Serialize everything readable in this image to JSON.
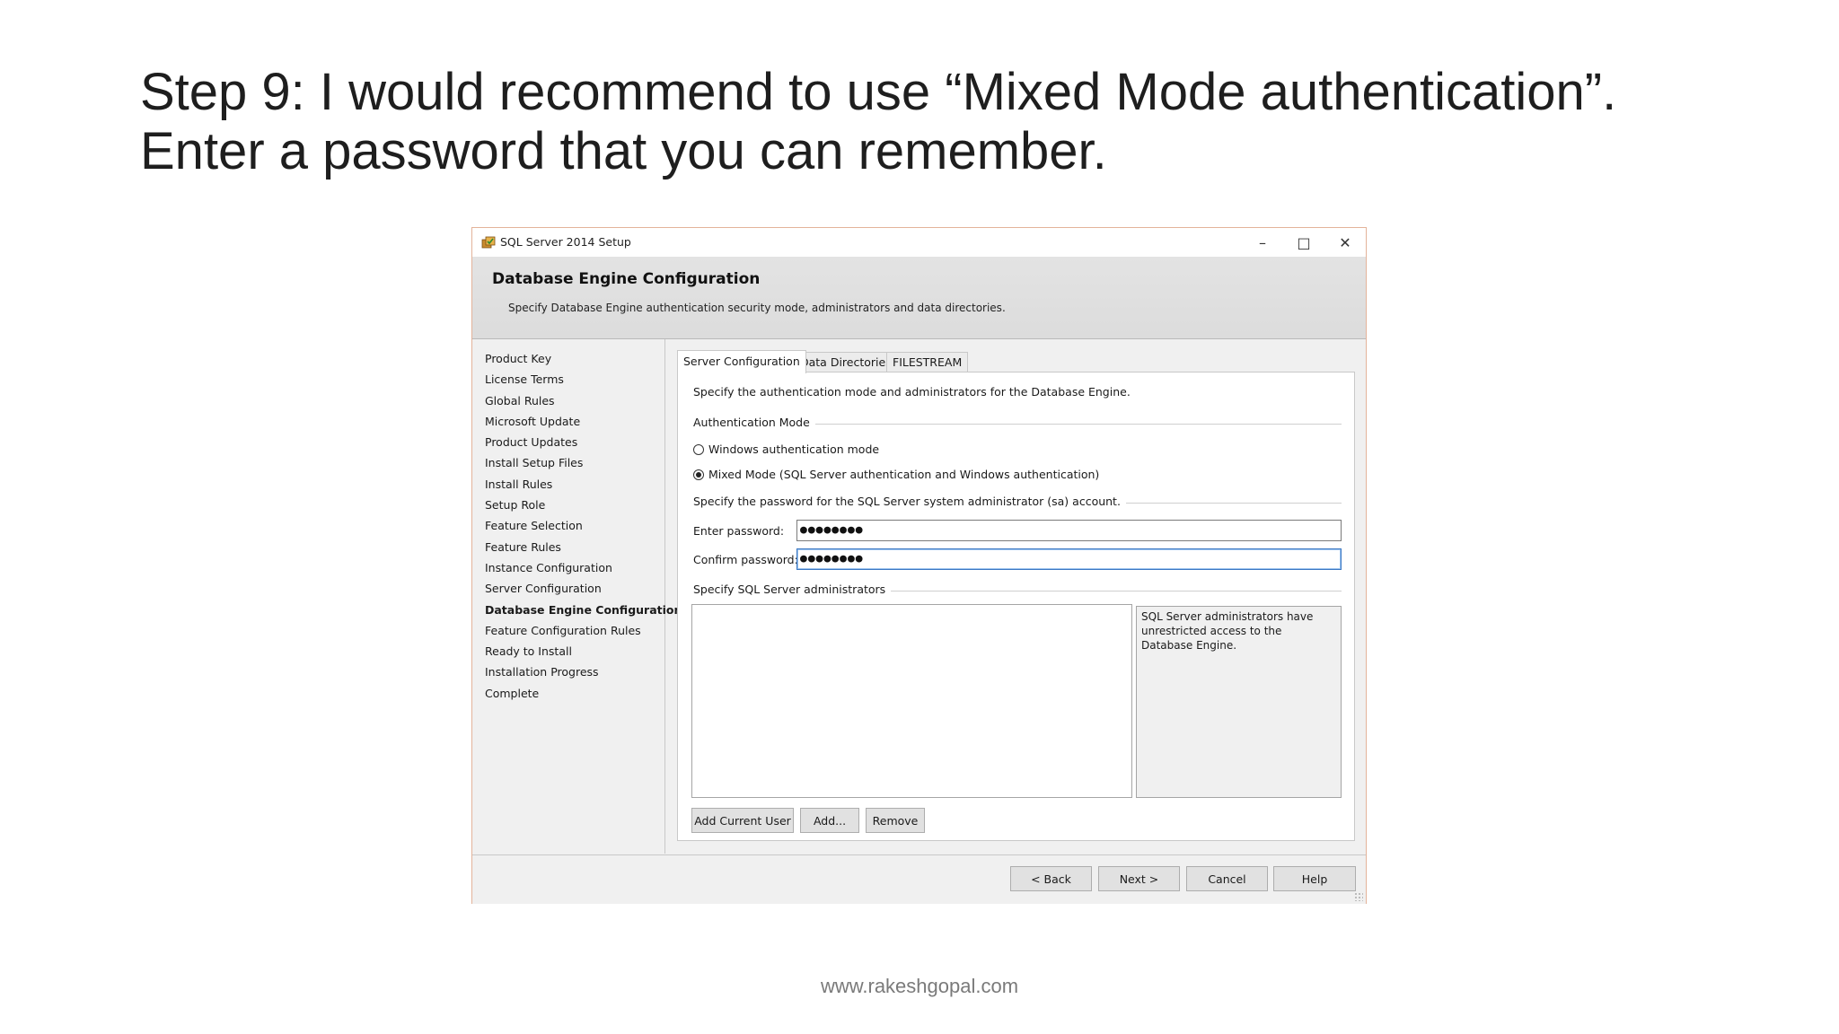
{
  "slide": {
    "title": "Step 9: I would recommend to use “Mixed Mode authentication”. Enter a password that you can remember.",
    "footer": "www.rakeshgopal.com"
  },
  "window": {
    "title": "SQL Server 2014 Setup",
    "controls": {
      "minimize": "–",
      "maximize": "□",
      "close": "✕"
    }
  },
  "header": {
    "title": "Database Engine Configuration",
    "description": "Specify Database Engine authentication security mode, administrators and data directories."
  },
  "sidebar": {
    "items": [
      {
        "label": "Product Key"
      },
      {
        "label": "License Terms"
      },
      {
        "label": "Global Rules"
      },
      {
        "label": "Microsoft Update"
      },
      {
        "label": "Product Updates"
      },
      {
        "label": "Install Setup Files"
      },
      {
        "label": "Install Rules"
      },
      {
        "label": "Setup Role"
      },
      {
        "label": "Feature Selection"
      },
      {
        "label": "Feature Rules"
      },
      {
        "label": "Instance Configuration"
      },
      {
        "label": "Server Configuration"
      },
      {
        "label": "Database Engine Configuration",
        "current": true
      },
      {
        "label": "Feature Configuration Rules"
      },
      {
        "label": "Ready to Install"
      },
      {
        "label": "Installation Progress"
      },
      {
        "label": "Complete"
      }
    ]
  },
  "tabs": [
    {
      "label": "Server Configuration",
      "active": true
    },
    {
      "label": "Data Directories"
    },
    {
      "label": "FILESTREAM"
    }
  ],
  "panel": {
    "description": "Specify the authentication mode and administrators for the Database Engine.",
    "auth_group_label": "Authentication Mode",
    "radio_windows": {
      "label": "Windows authentication mode",
      "selected": false
    },
    "radio_mixed": {
      "label": "Mixed Mode (SQL Server authentication and Windows authentication)",
      "selected": true
    },
    "sa_group_label": "Specify the password for the SQL Server system administrator (sa) account.",
    "enter_password_label": "Enter password:",
    "enter_password_value": "●●●●●●●●",
    "confirm_password_label": "Confirm password:",
    "confirm_password_value": "●●●●●●●●",
    "admins_group_label": "Specify SQL Server administrators",
    "admins_info": "SQL Server administrators have unrestricted access to the Database Engine.",
    "add_current_user": "Add Current User",
    "add": "Add...",
    "remove": "Remove"
  },
  "footer_buttons": {
    "back": "< Back",
    "next": "Next >",
    "cancel": "Cancel",
    "help": "Help"
  }
}
